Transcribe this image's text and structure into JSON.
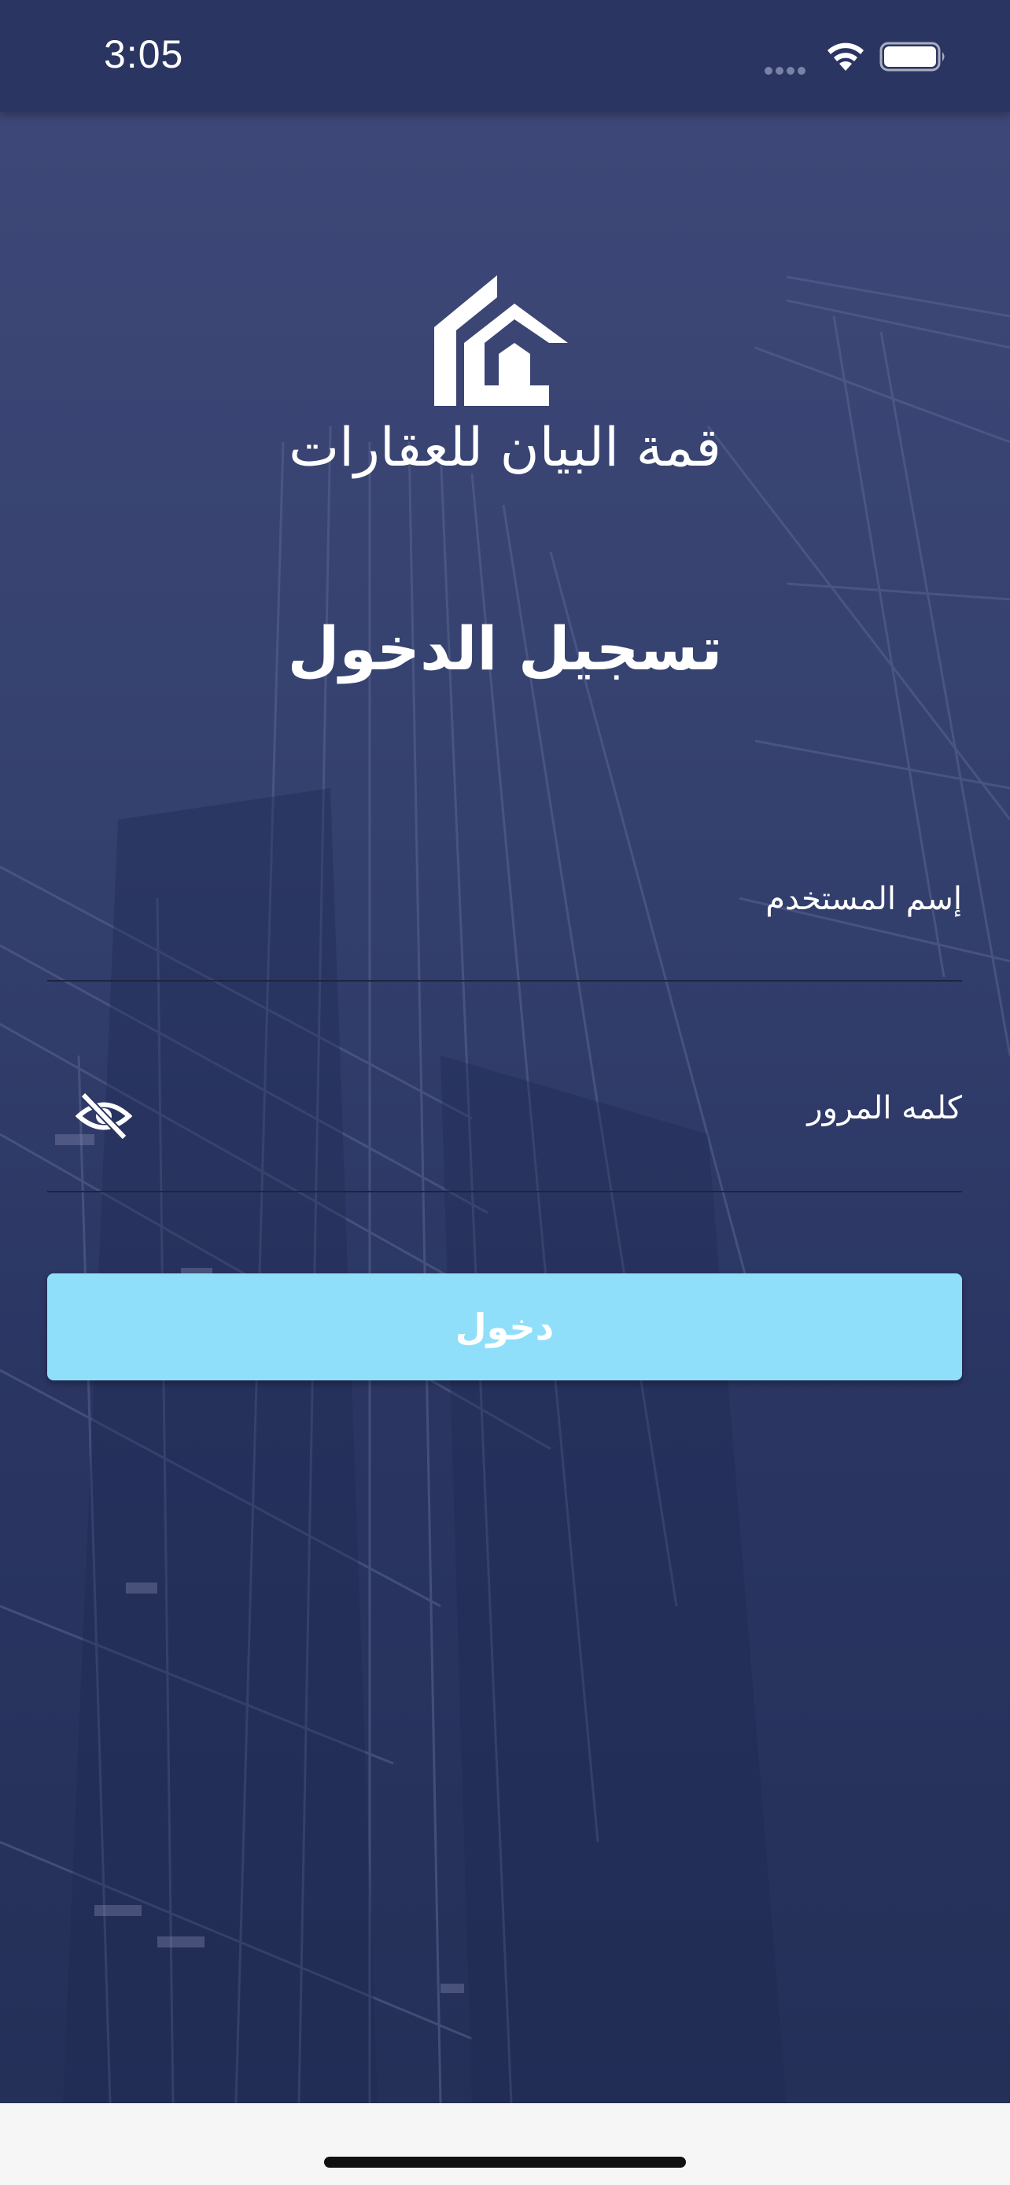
{
  "status_bar": {
    "time": "3:05"
  },
  "brand": {
    "name": "قمة البيان للعقارات",
    "logo_icon": "house-logo-icon"
  },
  "login": {
    "title": "تسجيل الدخول",
    "username_label": "إسم المستخدم",
    "username_value": "",
    "password_label": "كلمه المرور",
    "password_value": "",
    "password_visibility_icon": "eye-off-icon",
    "submit_label": "دخول"
  },
  "colors": {
    "background": "#2b3560",
    "button": "#8fdffa",
    "text": "#ffffff"
  }
}
